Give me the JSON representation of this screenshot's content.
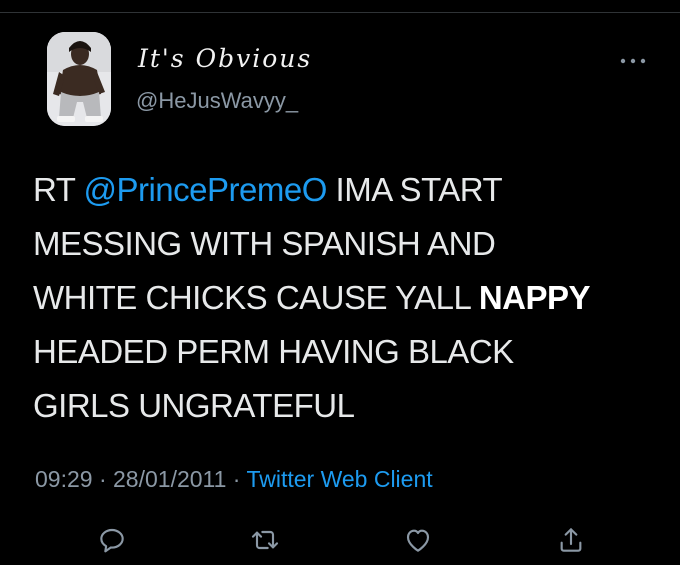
{
  "tweet": {
    "display_name": "It's Obvious",
    "handle": "@HeJusWavyy_",
    "text_prefix": "RT ",
    "mention": "@PrincePremeO",
    "text_line1_rest": " IMA START",
    "text_line2": "MESSING WITH SPANISH AND",
    "text_line3_pre": "WHITE CHICKS CAUSE YALL ",
    "text_line3_bold": "NAPPY",
    "text_line4": "HEADED PERM HAVING BLACK",
    "text_line5": "GIRLS UNGRATEFUL",
    "time": "09:29",
    "separator": " · ",
    "date": "28/01/2011",
    "client": "Twitter Web Client"
  },
  "icons": {
    "more": "more-horizontal-icon",
    "reply": "reply-icon",
    "retweet": "retweet-icon",
    "like": "heart-icon",
    "share": "share-icon"
  },
  "colors": {
    "background": "#000000",
    "text": "#e7e9ea",
    "muted": "#8b98a5",
    "link": "#1d9bf0",
    "divider": "#2f3336"
  }
}
